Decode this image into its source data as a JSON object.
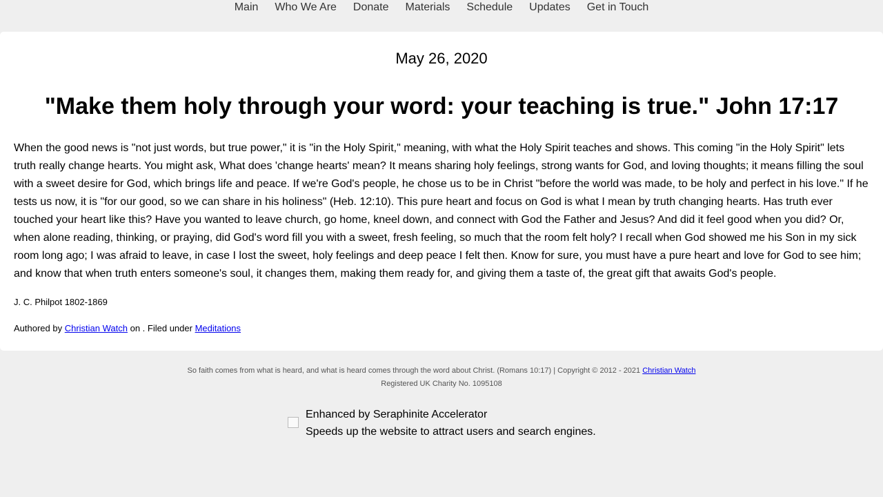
{
  "nav": {
    "items": [
      "Main",
      "Who We Are",
      "Donate",
      "Materials",
      "Schedule",
      "Updates",
      "Get in Touch"
    ]
  },
  "post": {
    "date": "May 26, 2020",
    "title": "\"Make them holy through your word: your teaching is true.\" John 17:17",
    "body": "When the good news is \"not just words, but true power,\" it is \"in the Holy Spirit,\" meaning, with what the Holy Spirit teaches and shows. This coming \"in the Holy Spirit\" lets truth really change hearts. You might ask, What does 'change hearts' mean? It means sharing holy feelings, strong wants for God, and loving thoughts; it means filling the soul with a sweet desire for God, which brings life and peace. If we're God's people, he chose us to be in Christ \"before the world was made, to be holy and perfect in his love.\" If he tests us now, it is \"for our good, so we can share in his holiness\" (Heb. 12:10). This pure heart and focus on God is what I mean by truth changing hearts. Has truth ever touched your heart like this? Have you wanted to leave church, go home, kneel down, and connect with God the Father and Jesus? And did it feel good when you did? Or, when alone reading, thinking, or praying, did God's word fill you with a sweet, fresh feeling, so much that the room felt holy? I recall when God showed me his Son in my sick room long ago; I was afraid to leave, in case I lost the sweet, holy feelings and deep peace I felt then. Know for sure, you must have a pure heart and love for God to see him; and know that when truth enters someone's soul, it changes them, making them ready for, and giving them a taste of, the great gift that awaits God's people.",
    "attribution": "J. C. Philpot 1802-1869",
    "meta": {
      "prefix": "Authored by ",
      "author": "Christian Watch",
      "middle": " on . Filed under ",
      "category": "Meditations"
    }
  },
  "footer": {
    "verse": "So faith comes from what is heard, and what is heard comes through the word about Christ. (Romans 10:17) | Copyright © 2012 - 2021 ",
    "copyright_link": "Christian Watch",
    "charity": "Registered UK Charity No. 1095108"
  },
  "badge": {
    "line1": "Enhanced by Seraphinite Accelerator",
    "line2": "Speeds up the website to attract users and search engines."
  }
}
